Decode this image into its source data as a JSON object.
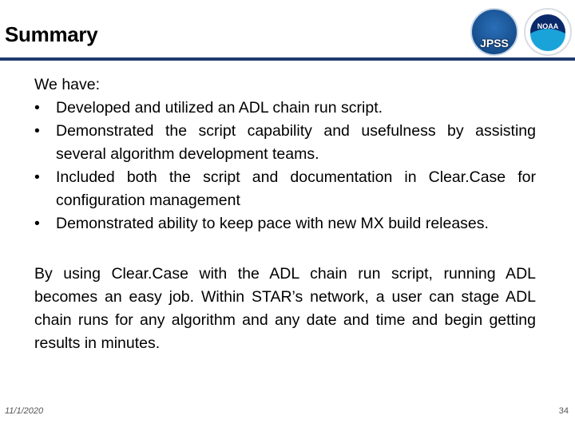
{
  "title": "Summary",
  "logos": {
    "jpss": "JPSS",
    "noaa": "NOAA"
  },
  "intro": "We have:",
  "bullets": [
    "Developed and utilized an ADL chain run script.",
    "Demonstrated the script capability and usefulness by assisting several algorithm development teams.",
    "Included both the script and documentation in Clear.Case for configuration management",
    "Demonstrated ability to keep pace with new MX build releases."
  ],
  "paragraph": "By using Clear.Case with the ADL chain run script, running ADL becomes an easy job. Within STAR’s network, a user can stage ADL chain runs for any algorithm and any date and time and begin getting results in minutes.",
  "footer": {
    "date": "11/1/2020",
    "page": "34"
  },
  "colors": {
    "rule": "#1f3a6e"
  }
}
